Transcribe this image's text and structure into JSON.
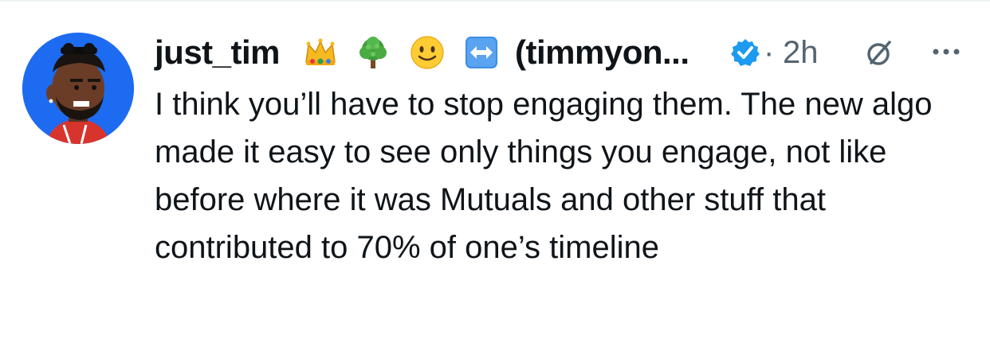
{
  "post": {
    "display_name": "just_tim",
    "emojis": [
      "crown-emoji",
      "tree-emoji",
      "slightly-smiling-face-emoji",
      "left-right-arrow-emoji"
    ],
    "handle_truncated": "(timmyon...",
    "verified": true,
    "separator": "·",
    "time": "2h",
    "text": "I think you’ll have to stop engaging them. The new algo made it easy to see only things you engage, not like before where it was Mutuals and other stuff that contributed to 70% of one’s timeline"
  },
  "colors": {
    "text": "#0f1419",
    "secondary": "#536471",
    "verified_blue": "#1d9bf0",
    "avatar_bg": "#1d6bf0"
  },
  "icons": {
    "verified": "verified-badge-icon",
    "grok": "grok-icon",
    "more": "more-icon"
  }
}
